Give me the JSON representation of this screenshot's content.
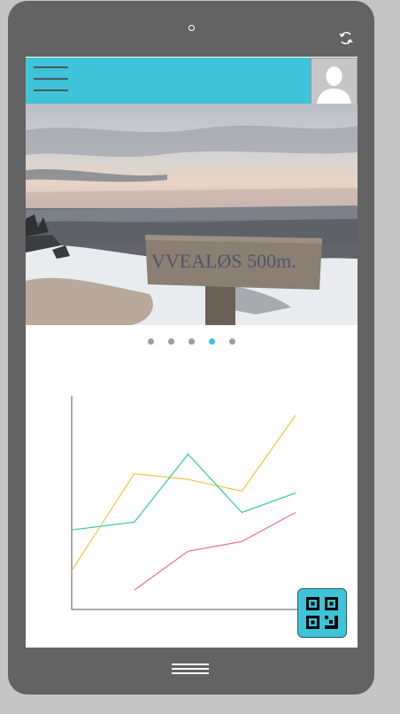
{
  "device": {
    "rotate_icon": "rotate-icon",
    "home_icon": "home-lines-icon"
  },
  "header": {
    "menu_icon": "hamburger-menu-icon",
    "avatar_icon": "user-avatar-icon",
    "accent_color": "#3ec3d8"
  },
  "carousel": {
    "image": "photo-sign-vvealos-500m",
    "sign_text": "VVEALØS 500m.",
    "slide_count": 5,
    "active_index": 3
  },
  "chart_data": {
    "type": "line",
    "x": [
      0,
      1,
      2,
      3,
      4
    ],
    "series": [
      {
        "values": [
          0.2,
          0.7,
          0.67,
          0.61,
          1.0
        ],
        "color": "#f3c23a"
      },
      {
        "values": [
          0.41,
          0.45,
          0.8,
          0.5,
          0.6
        ],
        "color": "#3ec8a8"
      },
      {
        "values": [
          null,
          0.1,
          0.3,
          0.35,
          0.5
        ],
        "color": "#e86aa6"
      }
    ],
    "ylim": [
      0,
      1.1
    ],
    "xlabel": "",
    "ylabel": ""
  },
  "qr_button": {
    "icon": "qr-code-icon"
  }
}
